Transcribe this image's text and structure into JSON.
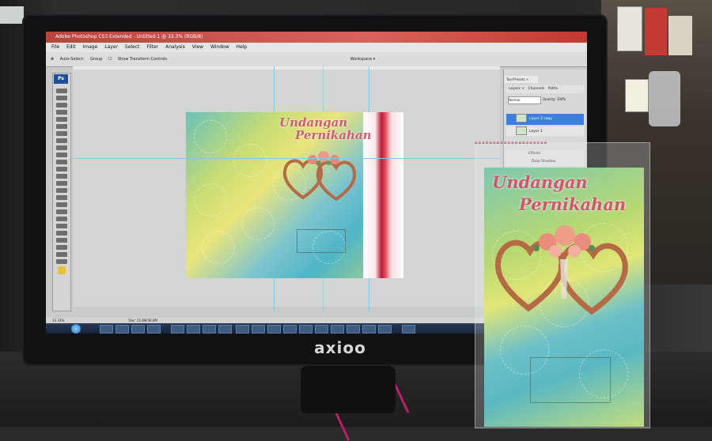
{
  "monitor": {
    "brand": "axioo"
  },
  "photoshop": {
    "window_title": "Adobe Photoshop CS3 Extended - Untitled-1 @ 33.3% (RGB/8)",
    "badge": "Ps",
    "menu": [
      "File",
      "Edit",
      "Image",
      "Layer",
      "Select",
      "Filter",
      "Analysis",
      "View",
      "Window",
      "Help"
    ],
    "options": {
      "auto_select_label": "Auto-Select:",
      "auto_select_value": "Group",
      "transform_label": "Show Transform Controls",
      "workspace_label": "Workspace ▾"
    },
    "panels": {
      "tool_presets_tab": "Tool Presets ×",
      "layers_tabs": [
        "Layers ×",
        "Channels",
        "Paths"
      ],
      "blend_mode": "Normal",
      "opacity": "Opacity: 100%",
      "layers": [
        "Layer 2 copy",
        "Layer 1",
        "Effects",
        "Drop Shadow"
      ]
    },
    "status": {
      "zoom": "33.33%",
      "doc": "Doc: 22.8M/36.8M"
    }
  },
  "design": {
    "title_line1": "Undangan",
    "title_line2": "Pernikahan"
  },
  "printed_card": {
    "title_line1": "Undangan",
    "title_line2": "Pernikahan"
  },
  "colors": {
    "title_pink": "#d2556f",
    "lace_red": "#b91f37",
    "selected_layer": "#3d7fe0"
  }
}
